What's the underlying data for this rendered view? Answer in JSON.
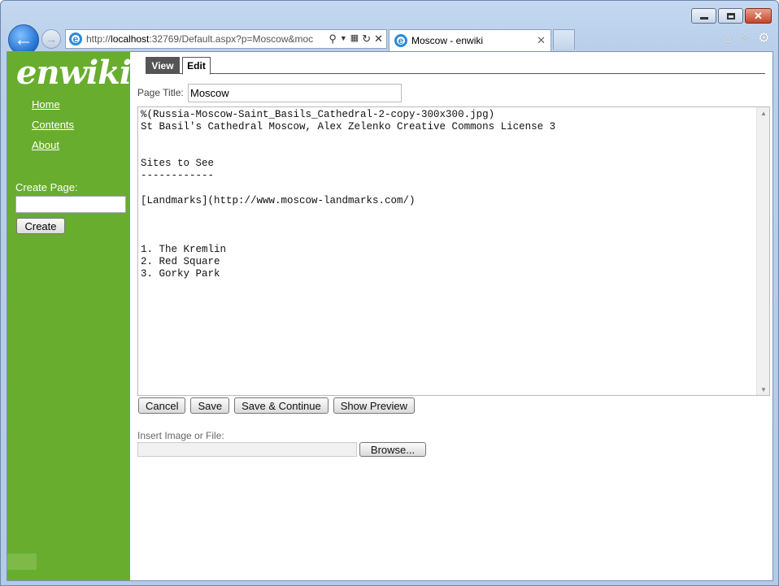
{
  "browser": {
    "address_prefix": "http://",
    "address_host": "localhost",
    "address_rest": ":32769/Default.aspx?p=Moscow&moc",
    "tab_title": "Moscow - enwiki"
  },
  "sidebar": {
    "logo": "enwiki",
    "nav": [
      {
        "label": "Home"
      },
      {
        "label": "Contents"
      },
      {
        "label": "About"
      }
    ],
    "create_label": "Create Page:",
    "create_input_value": "",
    "create_button": "Create"
  },
  "tabs": {
    "view": "View",
    "edit": "Edit"
  },
  "editor": {
    "title_label": "Page Title:",
    "title_value": "Moscow",
    "body": "%(Russia-Moscow-Saint_Basils_Cathedral-2-copy-300x300.jpg)\nSt Basil's Cathedral Moscow, Alex Zelenko Creative Commons License 3\n\n\nSites to See\n------------\n\n[Landmarks](http://www.moscow-landmarks.com/)\n\n\n\n1. The Kremlin\n2. Red Square\n3. Gorky Park",
    "buttons": {
      "cancel": "Cancel",
      "save": "Save",
      "save_continue": "Save & Continue",
      "preview": "Show Preview"
    },
    "insert_label": "Insert Image or File:",
    "file_value": "",
    "browse": "Browse..."
  },
  "colors": {
    "sidebar": "#68ad2e",
    "view_tab": "#555555"
  }
}
